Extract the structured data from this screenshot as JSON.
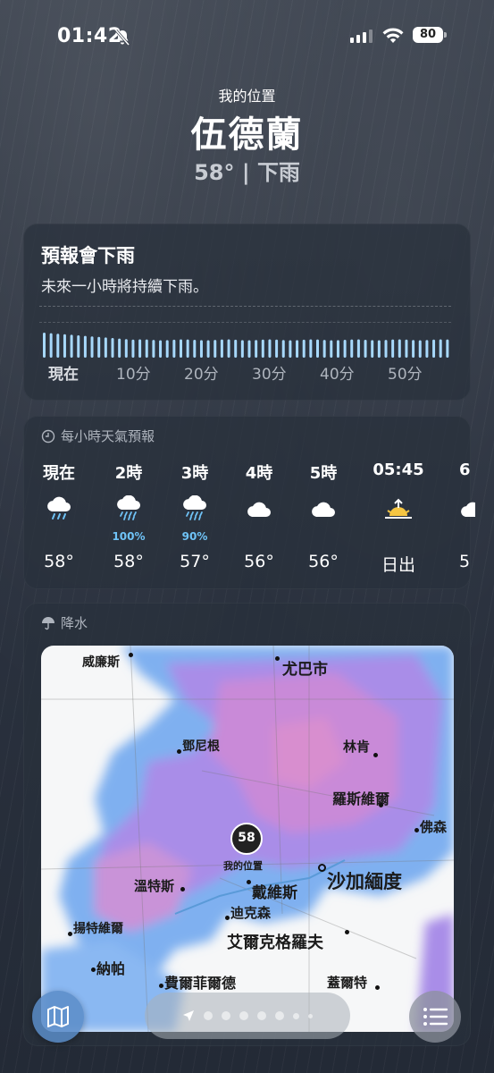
{
  "status": {
    "time": "01:42",
    "battery": "80"
  },
  "header": {
    "location_label": "我的位置",
    "city": "伍德蘭",
    "condition": "58° | 下雨"
  },
  "precip_forecast": {
    "title": "預報會下雨",
    "subtitle": "未來一小時將持續下雨。",
    "ticks": [
      "現在",
      "10分",
      "20分",
      "30分",
      "40分",
      "50分"
    ]
  },
  "hourly": {
    "header": "每小時天氣預報",
    "items": [
      {
        "label": "現在",
        "icon": "rain-cloud-icon",
        "pct": "",
        "temp": "58°"
      },
      {
        "label": "2時",
        "icon": "heavy-rain-cloud-icon",
        "pct": "100%",
        "temp": "58°"
      },
      {
        "label": "3時",
        "icon": "heavy-rain-cloud-icon",
        "pct": "90%",
        "temp": "57°"
      },
      {
        "label": "4時",
        "icon": "cloud-icon",
        "pct": "",
        "temp": "56°"
      },
      {
        "label": "5時",
        "icon": "cloud-icon",
        "pct": "",
        "temp": "56°"
      },
      {
        "label": "05:45",
        "icon": "sunrise-icon",
        "pct": "",
        "temp": "日出"
      },
      {
        "label": "6",
        "icon": "cloud-icon",
        "pct": "",
        "temp": "5"
      }
    ]
  },
  "precip_map": {
    "header": "降水",
    "marker_value": "58",
    "my_location": "我的位置",
    "cities": {
      "williams": "威廉斯",
      "yuba_city": "尤巴市",
      "chico": "鄧尼根",
      "lincoln": "林肯",
      "roseville": "羅斯維爾",
      "folsom": "佛森",
      "winters": "溫特斯",
      "davis": "戴維斯",
      "sacramento": "沙加緬度",
      "dixon": "迪克森",
      "elk_grove": "艾爾克格羅夫",
      "vacaville": "揚特維爾",
      "napa": "納帕",
      "fairfield": "費爾菲爾德",
      "galt": "蓋爾特"
    }
  },
  "colors": {
    "accent_blue": "#6fc3f7",
    "map_button": "#5a8cc8"
  }
}
